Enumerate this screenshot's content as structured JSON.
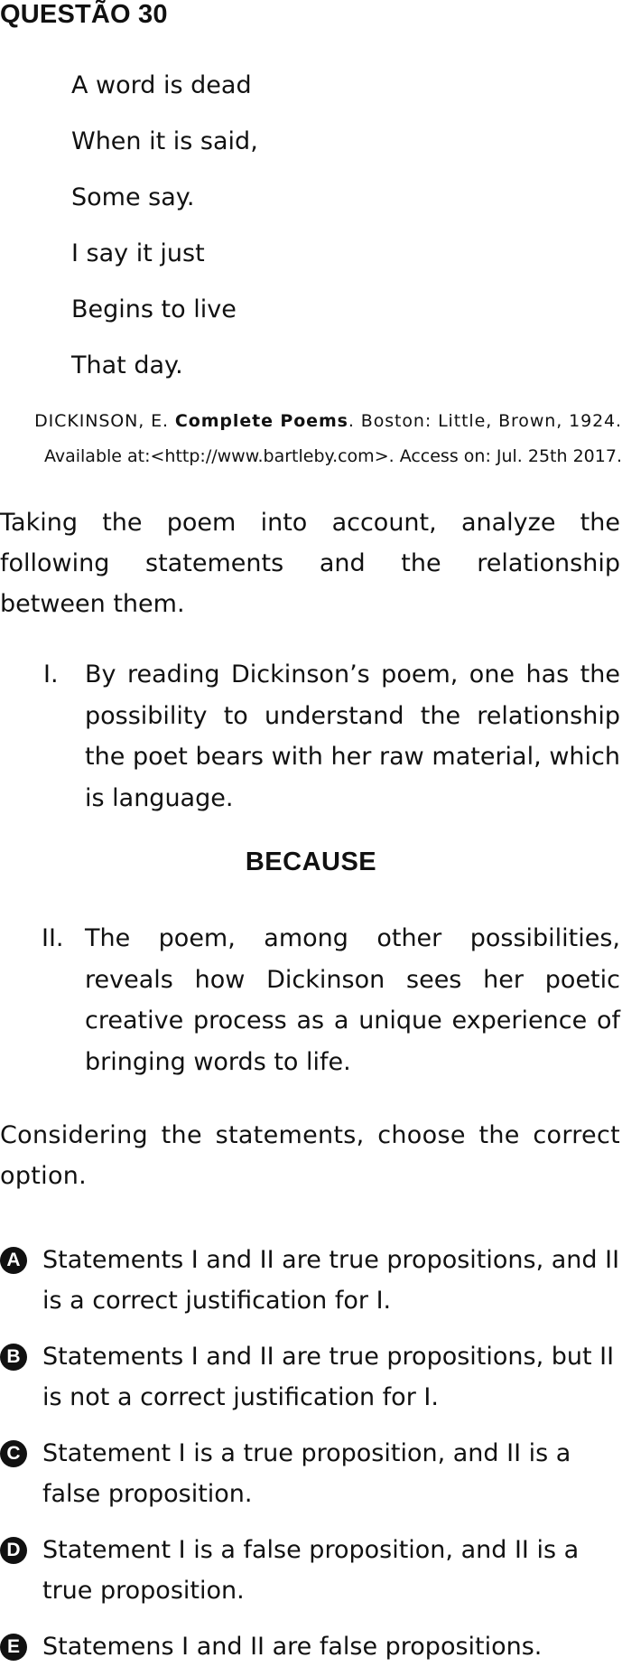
{
  "question": {
    "title": "QUESTÃO 30"
  },
  "poem": {
    "lines": [
      "A word is dead",
      "When it is said,",
      "Some say.",
      "I say it just",
      "Begins to live",
      "That day."
    ]
  },
  "citation": {
    "author": "DICKINSON, E. ",
    "book": "Complete Poems",
    "publisher": ". Boston: Little, Brown, 1924.",
    "availability": "Available at:<http://www.bartleby.com>. Access on: Jul. 25th 2017."
  },
  "prompt": "Taking the poem into account, analyze the following statements and the relationship between them.",
  "statements": [
    {
      "num": "I.",
      "text": "By reading Dickinson’s poem, one has the possibility to understand the relationship the poet bears with her raw material, which is language."
    },
    {
      "num": "II.",
      "text": "The poem, among other possibilities, reveals how Dickinson sees her poetic creative process as a unique experience of bringing words to life."
    }
  ],
  "connector": "BECAUSE",
  "instruction": "Considering the statements, choose the correct option.",
  "options": [
    {
      "letter": "A",
      "text": "Statements I and II are true propositions, and II is a correct justification for I."
    },
    {
      "letter": "B",
      "text": "Statements I and II are true propositions, but II is not a correct justification for I."
    },
    {
      "letter": "C",
      "text": "Statement I is a true proposition, and II is a false proposition."
    },
    {
      "letter": "D",
      "text": "Statement I is a false proposition, and II is a true proposition."
    },
    {
      "letter": "E",
      "text": "Statemens I and II are false propositions."
    }
  ]
}
